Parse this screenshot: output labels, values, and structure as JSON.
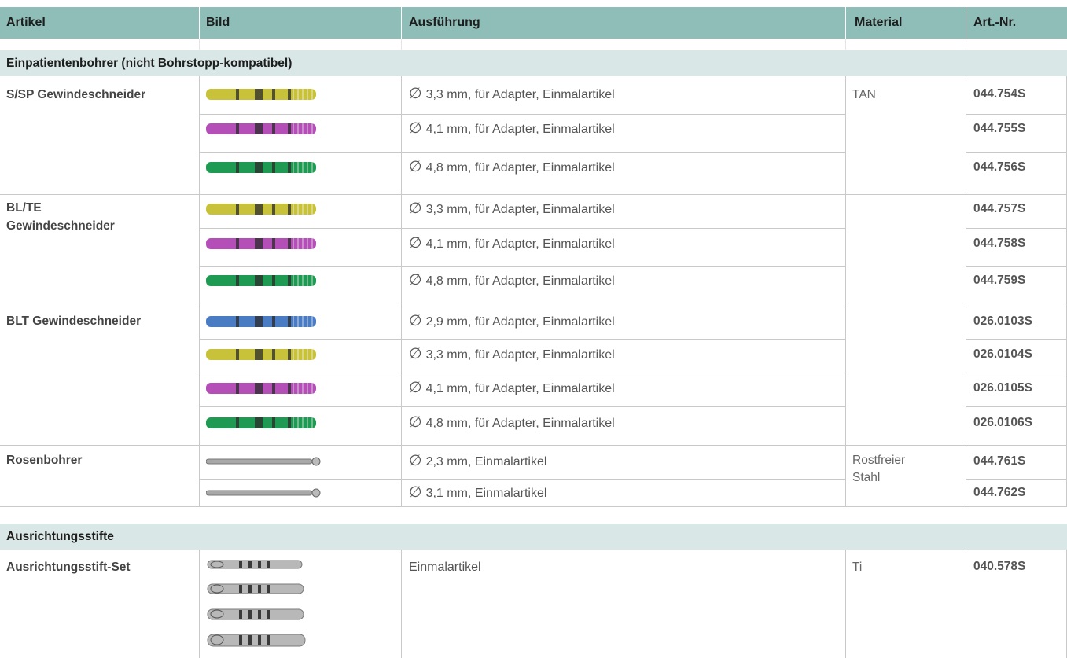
{
  "header": {
    "col_artikel": "Artikel",
    "col_bild": "Bild",
    "col_ausfuehrung": "Ausführung",
    "col_material": "Material",
    "col_artnr": "Art.-Nr."
  },
  "sections": [
    {
      "title": "Einpatientenbohrer (nicht Bohrstopp-kompatibel)",
      "rows": [
        {
          "artikel": "S/SP Gewindeschneider",
          "diameter": "3,3",
          "desc": "mm, für Adapter, Einmalartikel",
          "nr": "044.754S",
          "color": "#c8c23a"
        },
        {
          "diameter": "4,1",
          "desc": "mm, für Adapter, Einmalartikel",
          "nr": "044.755S",
          "color": "#b34fb7"
        },
        {
          "diameter": "4,8",
          "desc": "mm, für Adapter, Einmalartikel",
          "nr": "044.756S",
          "color": "#1f9a52"
        },
        {
          "artikel_line1": "BL/TE",
          "artikel_line2": "Gewindeschneider",
          "diameter": "3,3",
          "desc": "mm, für Adapter, Einmalartikel",
          "nr": "044.757S",
          "color": "#c8c23a"
        },
        {
          "diameter": "4,1",
          "desc": "mm, für Adapter, Einmalartikel",
          "nr": "044.758S",
          "color": "#b34fb7"
        },
        {
          "diameter": "4,8",
          "desc": "mm, für Adapter, Einmalartikel",
          "nr": "044.759S",
          "color": "#1f9a52"
        },
        {
          "artikel": "BLT Gewindeschneider",
          "diameter": "2,9",
          "desc": "mm, für Adapter, Einmalartikel",
          "nr": "026.0103S",
          "color": "#4a7cc4"
        },
        {
          "diameter": "3,3",
          "desc": "mm, für Adapter, Einmalartikel",
          "nr": "026.0104S",
          "color": "#c8c23a"
        },
        {
          "diameter": "4,1",
          "desc": "mm, für Adapter, Einmalartikel",
          "nr": "026.0105S",
          "color": "#b34fb7"
        },
        {
          "diameter": "4,8",
          "desc": "mm, für Adapter, Einmalartikel",
          "nr": "026.0106S",
          "color": "#1f9a52"
        },
        {
          "artikel": "Rosenbohrer",
          "diameter": "2,3",
          "desc": "mm, Einmalartikel",
          "nr": "044.761S",
          "color": "#a8a8a8"
        },
        {
          "diameter": "3,1",
          "desc": "mm, Einmalartikel",
          "nr": "044.762S",
          "color": "#a8a8a8"
        }
      ],
      "material_tan": "TAN",
      "material_steel_line1": "Rostfreier",
      "material_steel_line2": "Stahl"
    },
    {
      "title": "Ausrichtungsstifte",
      "rows": [
        {
          "artikel": "Ausrichtungsstift-Set",
          "desc": "Einmalartikel",
          "material": "Ti",
          "nr": "040.578S",
          "color": "#b0b0b0"
        }
      ]
    }
  ],
  "diameter_symbol": "∅"
}
